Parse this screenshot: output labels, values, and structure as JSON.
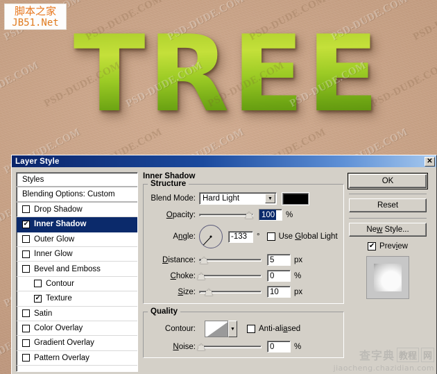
{
  "backdrop": {
    "headline": "TREE",
    "background_color": "#c6a084",
    "tile_watermark": "PSD-DUDE.COM"
  },
  "site_logo": {
    "cn": "脚本之家",
    "en": "JB51.Net"
  },
  "corner_watermark": {
    "cn_left": "查字典",
    "cn_mid": "教程",
    "cn_right": "网",
    "url": "jiaocheng.chazidian.com"
  },
  "dialog": {
    "title": "Layer Style",
    "close_label": "✕"
  },
  "styles_list": {
    "header": "Styles",
    "blending_options": "Blending Options: Custom",
    "items": [
      {
        "label": "Drop Shadow",
        "checked": false,
        "indent": false,
        "selected": false
      },
      {
        "label": "Inner Shadow",
        "checked": true,
        "indent": false,
        "selected": true
      },
      {
        "label": "Outer Glow",
        "checked": false,
        "indent": false,
        "selected": false
      },
      {
        "label": "Inner Glow",
        "checked": false,
        "indent": false,
        "selected": false
      },
      {
        "label": "Bevel and Emboss",
        "checked": false,
        "indent": false,
        "selected": false
      },
      {
        "label": "Contour",
        "checked": false,
        "indent": true,
        "selected": false
      },
      {
        "label": "Texture",
        "checked": true,
        "indent": true,
        "selected": false
      },
      {
        "label": "Satin",
        "checked": false,
        "indent": false,
        "selected": false
      },
      {
        "label": "Color Overlay",
        "checked": false,
        "indent": false,
        "selected": false
      },
      {
        "label": "Gradient Overlay",
        "checked": false,
        "indent": false,
        "selected": false
      },
      {
        "label": "Pattern Overlay",
        "checked": false,
        "indent": false,
        "selected": false
      }
    ],
    "check_glyph": "✔"
  },
  "panel": {
    "title": "Inner Shadow",
    "structure": {
      "legend": "Structure",
      "blend_mode_label": "Blend Mode:",
      "blend_mode_value": "Hard Light",
      "shadow_color": "#000000",
      "opacity_label": "Opacity:",
      "opacity_value": "100",
      "opacity_unit": "%",
      "angle_label": "Angle:",
      "angle_value": "-133",
      "angle_unit": "°",
      "use_global_light_label": "Use Global Light",
      "use_global_light_checked": false,
      "distance_label": "Distance:",
      "distance_value": "5",
      "distance_unit": "px",
      "choke_label": "Choke:",
      "choke_value": "0",
      "choke_unit": "%",
      "size_label": "Size:",
      "size_value": "10",
      "size_unit": "px"
    },
    "quality": {
      "legend": "Quality",
      "contour_label": "Contour:",
      "anti_aliased_label": "Anti-aliased",
      "anti_aliased_checked": false,
      "noise_label": "Noise:",
      "noise_value": "0",
      "noise_unit": "%"
    }
  },
  "actions": {
    "ok": "OK",
    "reset": "Reset",
    "new_style": "New Style...",
    "preview_label": "Preview",
    "preview_checked": true,
    "check_glyph": "✔"
  },
  "dropdown_glyph": "▼"
}
